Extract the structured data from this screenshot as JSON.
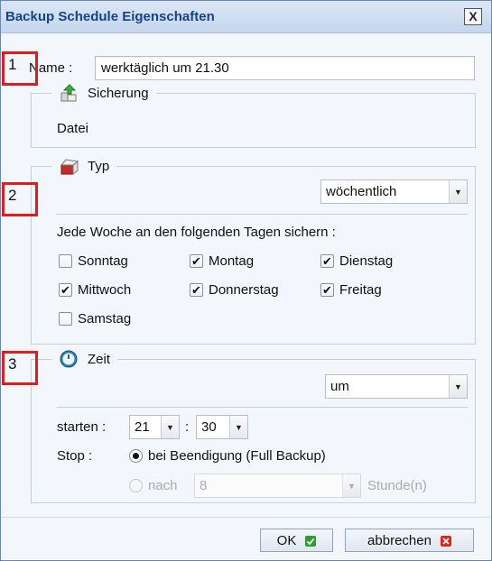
{
  "window": {
    "title": "Backup Schedule Eigenschaften",
    "close_label": "X"
  },
  "name": {
    "label": "Name :",
    "value": "werktäglich um 21.30"
  },
  "sicherung": {
    "legend": "Sicherung",
    "value": "Datei"
  },
  "typ": {
    "legend": "Typ",
    "frequency": "wöchentlich",
    "instruction": "Jede Woche an den folgenden Tagen sichern :",
    "days": [
      {
        "label": "Sonntag",
        "checked": false
      },
      {
        "label": "Montag",
        "checked": true
      },
      {
        "label": "Dienstag",
        "checked": true
      },
      {
        "label": "Mittwoch",
        "checked": true
      },
      {
        "label": "Donnerstag",
        "checked": true
      },
      {
        "label": "Freitag",
        "checked": true
      },
      {
        "label": "Samstag",
        "checked": false
      }
    ]
  },
  "zeit": {
    "legend": "Zeit",
    "mode": "um",
    "start_label": "starten :",
    "hour": "21",
    "colon": ":",
    "minute": "30",
    "stop_label": "Stop :",
    "stop_options": [
      {
        "label": "bei Beendigung (Full Backup)",
        "selected": true,
        "enabled": true
      },
      {
        "label": "nach",
        "selected": false,
        "enabled": false
      }
    ],
    "after_value": "8",
    "hours_unit": "Stunde(n)"
  },
  "buttons": {
    "ok": "OK",
    "cancel": "abbrechen"
  },
  "markers": [
    "1",
    "2",
    "3"
  ],
  "colors": {
    "marker": "#e21c1c",
    "title": "#15428b",
    "ok_icon": "#2f9e2f",
    "cancel_icon": "#d9261c"
  }
}
